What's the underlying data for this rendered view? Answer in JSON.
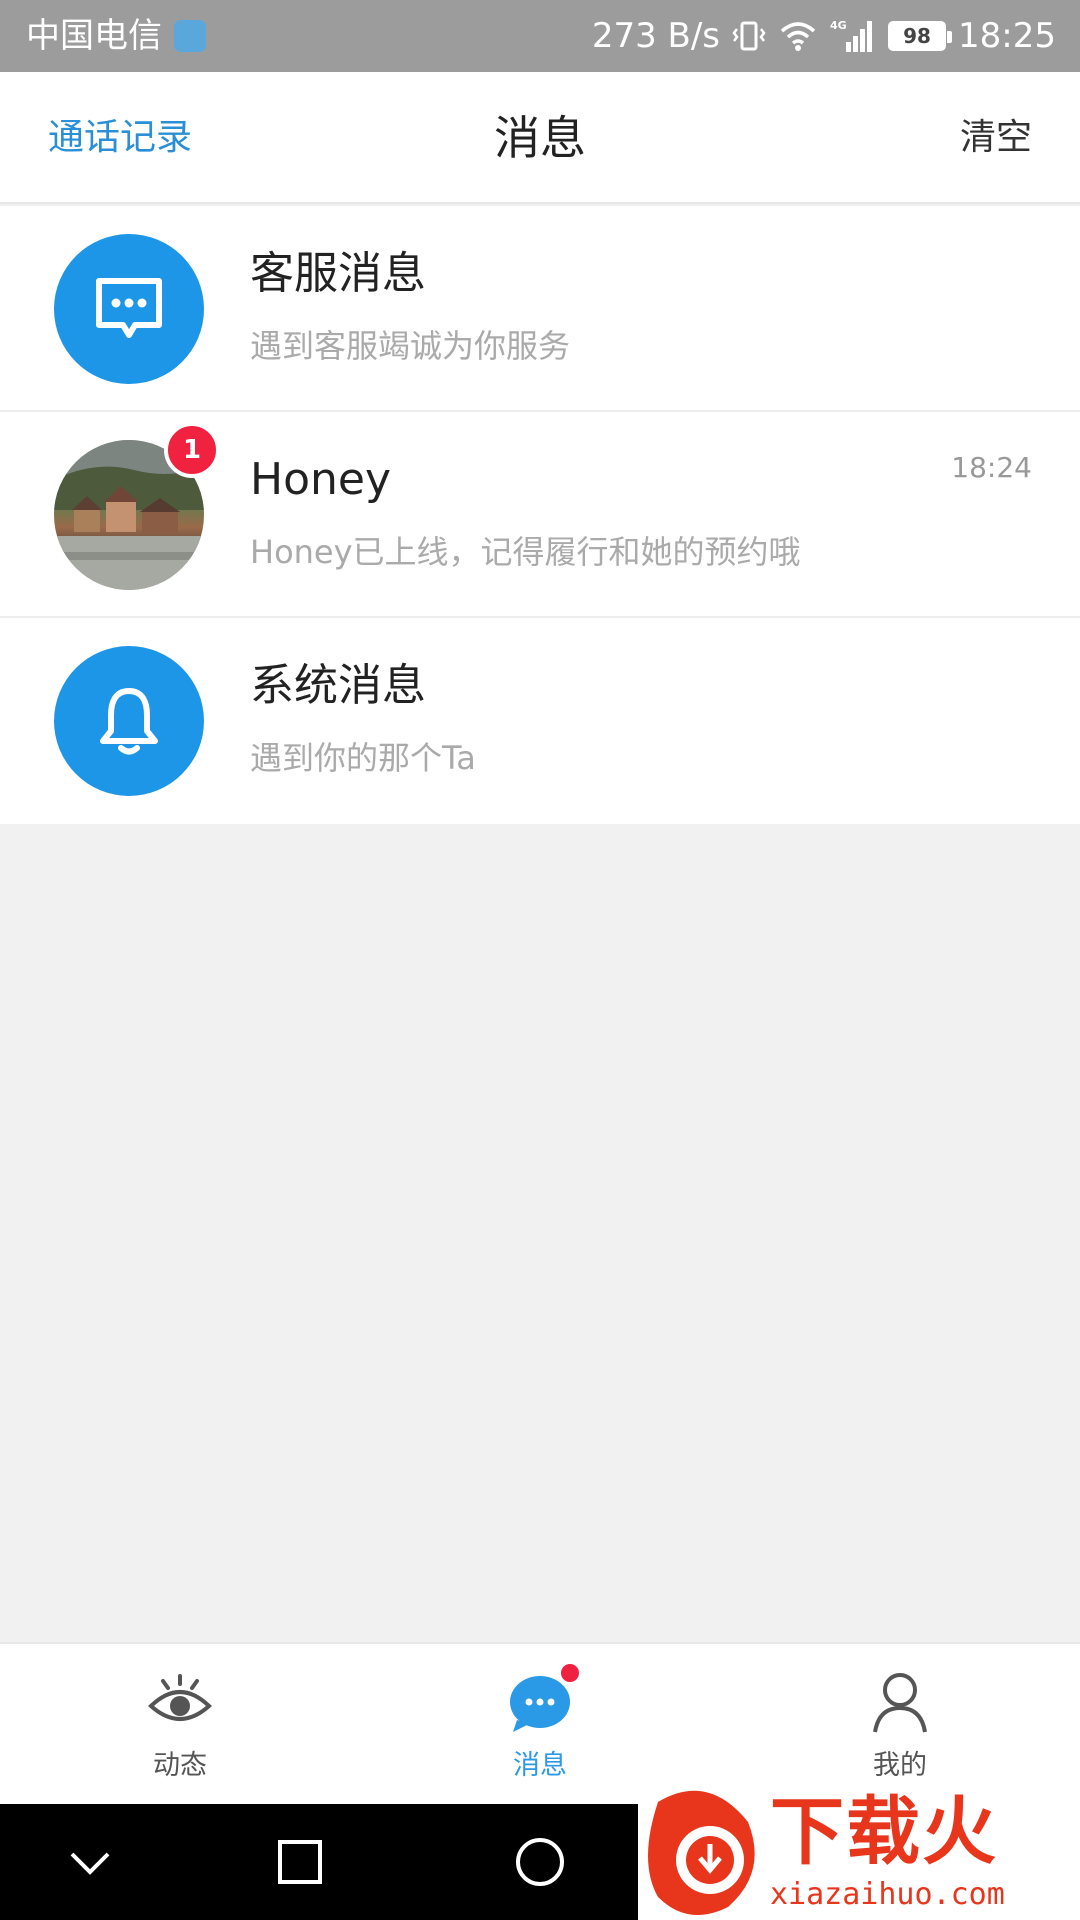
{
  "status_bar": {
    "carrier": "中国电信",
    "net_speed": "273 B/s",
    "network": "4G",
    "battery": "98",
    "time": "18:25"
  },
  "header": {
    "left_link": "通话记录",
    "title": "消息",
    "right_link": "清空"
  },
  "messages": [
    {
      "name": "客服消息",
      "preview": "遇到客服竭诚为你服务",
      "time": "",
      "icon": "chat-bubble-icon",
      "badge": ""
    },
    {
      "name": "Honey",
      "preview": "Honey已上线，记得履行和她的预约哦",
      "time": "18:24",
      "icon": "avatar-photo",
      "badge": "1"
    },
    {
      "name": "系统消息",
      "preview": "遇到你的那个Ta",
      "time": "",
      "icon": "bell-icon",
      "badge": ""
    }
  ],
  "tabs": [
    {
      "label": "动态",
      "icon": "eye-icon",
      "active": false
    },
    {
      "label": "消息",
      "icon": "chat-bubble-icon",
      "active": true,
      "has_dot": true
    },
    {
      "label": "我的",
      "icon": "person-icon",
      "active": false
    }
  ],
  "watermark": {
    "text": "下载火",
    "url": "xiazaihuo.com"
  },
  "colors": {
    "accent": "#2a8fd6",
    "avatar_blue": "#1e96e8",
    "badge_red": "#f1223f",
    "status_bar": "#9c9c9c"
  }
}
